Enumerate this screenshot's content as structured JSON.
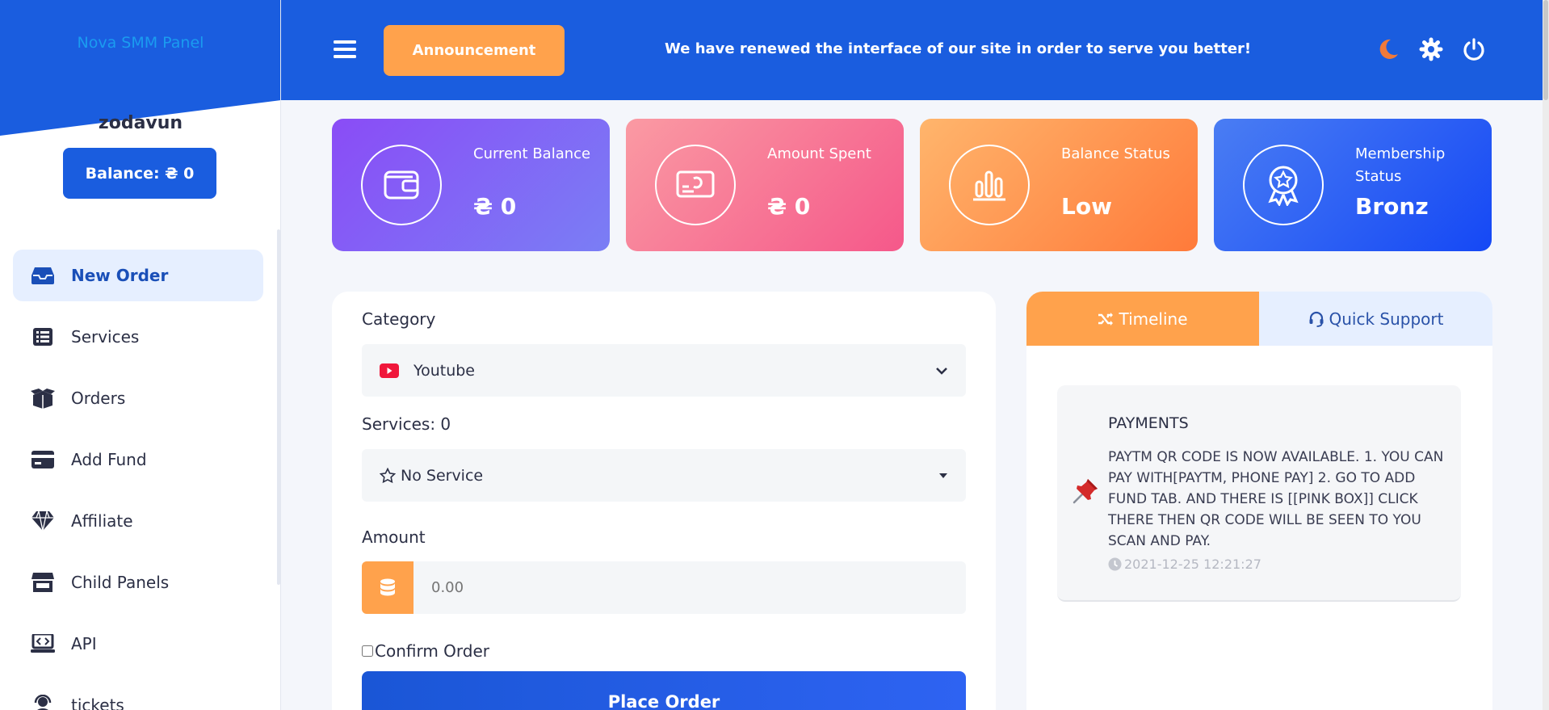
{
  "sidebar": {
    "brand": "Nova SMM Panel",
    "username": "zodavun",
    "balance_label": "Balance: ₴ 0",
    "items": [
      {
        "label": "New Order",
        "icon": "inbox-icon"
      },
      {
        "label": "Services",
        "icon": "list-icon"
      },
      {
        "label": "Orders",
        "icon": "box-icon"
      },
      {
        "label": "Add Fund",
        "icon": "credit-card-icon"
      },
      {
        "label": "Affiliate",
        "icon": "diamond-icon"
      },
      {
        "label": "Child Panels",
        "icon": "store-icon"
      },
      {
        "label": "API",
        "icon": "code-laptop-icon"
      },
      {
        "label": "tickets",
        "icon": "support-agent-icon"
      }
    ]
  },
  "header": {
    "announcement_label": "Announcement",
    "marquee": "We have renewed the interface of our site in order to serve you better!",
    "icons": [
      "menu-icon",
      "moon-icon",
      "gear-icon",
      "power-icon"
    ]
  },
  "stats": [
    {
      "label": "Current Balance",
      "value": "₴ 0",
      "icon": "wallet-icon"
    },
    {
      "label": "Amount Spent",
      "value": "₴ 0",
      "icon": "money-icon"
    },
    {
      "label": "Balance Status",
      "value": "Low",
      "icon": "bars-icon"
    },
    {
      "label": "Membership Status",
      "value": "Bronz",
      "icon": "award-icon"
    }
  ],
  "order": {
    "category_label": "Category",
    "category_value": "Youtube",
    "services_label": "Services: 0",
    "service_value": "No Service",
    "amount_label": "Amount",
    "amount_placeholder": "0.00",
    "confirm_label": "Confirm Order",
    "place_label": "Place Order"
  },
  "panel": {
    "tab_timeline": "Timeline",
    "tab_support": "Quick Support",
    "post": {
      "title": "PAYMENTS",
      "body": "PAYTM QR CODE IS NOW AVAILABLE. 1. YOU CAN PAY WITH[PAYTM, PHONE PAY] 2. GO TO ADD FUND TAB. AND THERE IS [[PINK BOX]] CLICK THERE THEN QR CODE WILL BE SEEN TO YOU SCAN AND PAY.",
      "time": "2021-12-25 12:21:27"
    }
  },
  "colors": {
    "primary": "#1a5ddf",
    "accent": "#ffa24c",
    "active_nav_bg": "#e6efff"
  }
}
